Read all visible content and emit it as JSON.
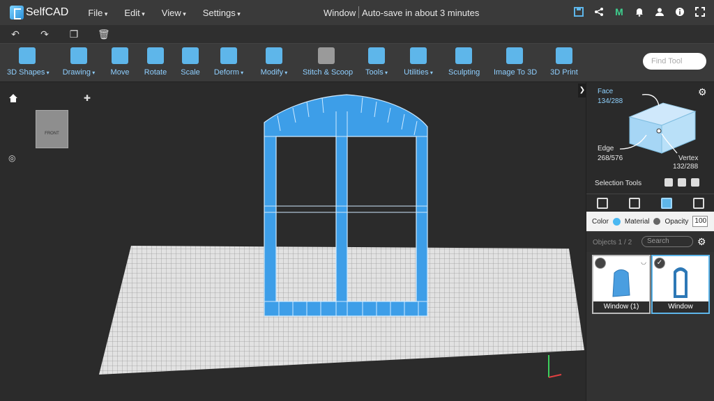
{
  "app": {
    "name": "SelfCAD"
  },
  "menu": [
    "File",
    "Edit",
    "View",
    "Settings"
  ],
  "document": {
    "title": "Window",
    "autosave": "Auto-save in about 3 minutes"
  },
  "top_icons": [
    "save-icon",
    "share-icon",
    "m-logo-icon",
    "bell-icon",
    "user-icon",
    "info-icon",
    "fullscreen-icon"
  ],
  "toolbar": {
    "tools": [
      {
        "label": "3D Shapes",
        "dropdown": true
      },
      {
        "label": "Drawing",
        "dropdown": true
      },
      {
        "label": "Move",
        "dropdown": false
      },
      {
        "label": "Rotate",
        "dropdown": false
      },
      {
        "label": "Scale",
        "dropdown": false
      },
      {
        "label": "Deform",
        "dropdown": true
      },
      {
        "label": "Modify",
        "dropdown": true
      },
      {
        "label": "Stitch & Scoop",
        "dropdown": false
      },
      {
        "label": "Tools",
        "dropdown": true
      },
      {
        "label": "Utilities",
        "dropdown": true
      },
      {
        "label": "Sculpting",
        "dropdown": false
      },
      {
        "label": "Image To 3D",
        "dropdown": false
      },
      {
        "label": "3D Print",
        "dropdown": false
      }
    ],
    "find_placeholder": "Find Tool"
  },
  "viewcube": {
    "face_label": "FRONT"
  },
  "selection": {
    "face_label": "Face",
    "face_count": "134/288",
    "edge_label": "Edge",
    "edge_count": "268/576",
    "vertex_label": "Vertex",
    "vertex_count": "132/288",
    "tools_label": "Selection Tools"
  },
  "properties": {
    "color_label": "Color",
    "color": "#4ab8f2",
    "material_label": "Material",
    "opacity_label": "Opacity",
    "opacity_value": "100"
  },
  "objects": {
    "count_label": "Objects 1 / 2",
    "search_placeholder": "Search",
    "items": [
      {
        "name": "Window (1)",
        "selected": false
      },
      {
        "name": "Window",
        "selected": true
      }
    ]
  },
  "colors": {
    "accent": "#4ab8f2",
    "model": "#3d9ee8"
  }
}
